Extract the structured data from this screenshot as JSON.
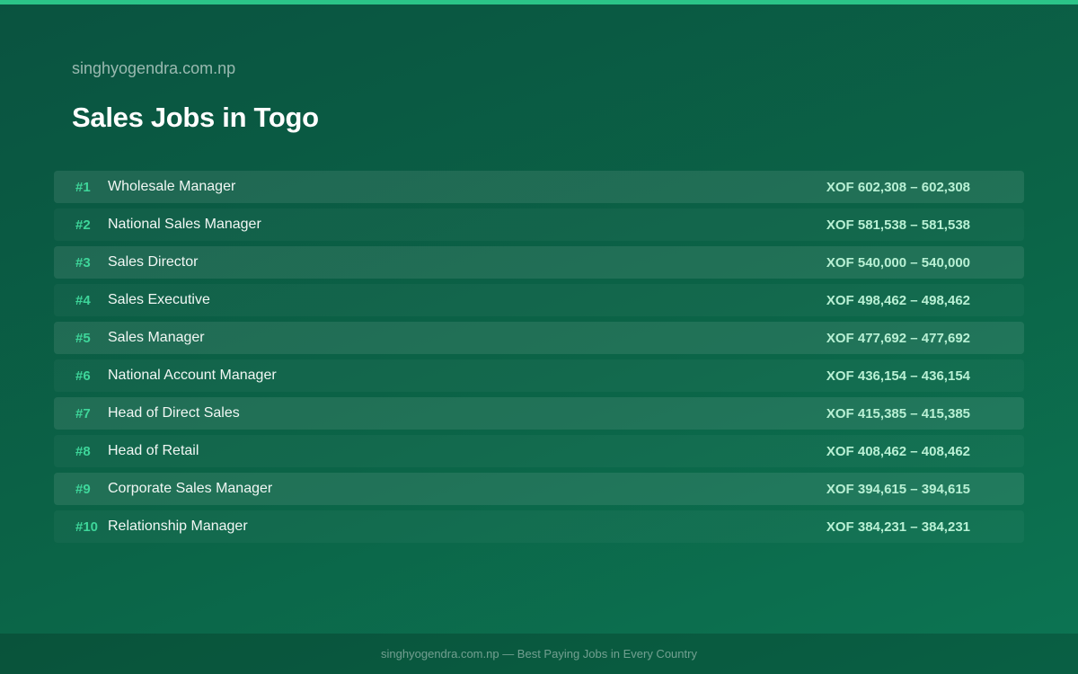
{
  "header": {
    "site_name": "singhyogendra.com.np",
    "title": "Sales Jobs in Togo"
  },
  "jobs": [
    {
      "rank": "#1",
      "title": "Wholesale Manager",
      "salary": "XOF 602,308 – 602,308"
    },
    {
      "rank": "#2",
      "title": "National Sales Manager",
      "salary": "XOF 581,538 – 581,538"
    },
    {
      "rank": "#3",
      "title": "Sales Director",
      "salary": "XOF 540,000 – 540,000"
    },
    {
      "rank": "#4",
      "title": "Sales Executive",
      "salary": "XOF 498,462 – 498,462"
    },
    {
      "rank": "#5",
      "title": "Sales Manager",
      "salary": "XOF 477,692 – 477,692"
    },
    {
      "rank": "#6",
      "title": "National Account Manager",
      "salary": "XOF 436,154 – 436,154"
    },
    {
      "rank": "#7",
      "title": "Head of Direct Sales",
      "salary": "XOF 415,385 – 415,385"
    },
    {
      "rank": "#8",
      "title": "Head of Retail",
      "salary": "XOF 408,462 – 408,462"
    },
    {
      "rank": "#9",
      "title": "Corporate Sales Manager",
      "salary": "XOF 394,615 – 394,615"
    },
    {
      "rank": "#10",
      "title": "Relationship Manager",
      "salary": "XOF 384,231 – 384,231"
    }
  ],
  "footer": {
    "text": "singhyogendra.com.np — Best Paying Jobs in Every Country"
  },
  "colors": {
    "accent": "#2bc488",
    "rank": "#3ed69a",
    "salary": "#b8f0d4",
    "background": "#0b6447"
  }
}
